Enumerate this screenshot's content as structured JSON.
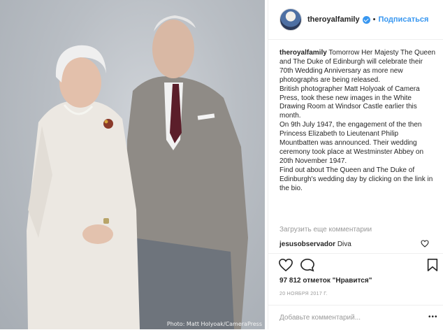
{
  "post": {
    "photo_credit": "Photo: Matt Holyoak/CameraPress"
  },
  "header": {
    "username": "theroyalfamily",
    "separator": "•",
    "follow_label": "Подписаться"
  },
  "caption": {
    "username": "theroyalfamily",
    "paragraphs": [
      "Tomorrow Her Majesty The Queen and The Duke of Edinburgh will celebrate their 70th Wedding Anniversary as more new photographs are being released.",
      "British photographer Matt Holyoak of Camera Press, took these new images in the White Drawing Room at Windsor Castle earlier this month.",
      "On 9th July 1947, the engagement of the then Princess Elizabeth to Lieutenant Philip Mountbatten was announced. Their wedding ceremony took place at Westminster Abbey on 20th November 1947.",
      "Find out about The Queen and The Duke of Edinburgh's wedding day by clicking on the link in the bio."
    ]
  },
  "comments": {
    "load_more_label": "Загрузить еще комментарии",
    "items": [
      {
        "username": "jesusobservador",
        "text": "Diva"
      }
    ]
  },
  "likes": {
    "text": "97 812 отметок \"Нравится\""
  },
  "date": "20 НОЯБРЯ 2017 Г.",
  "comment_input": {
    "placeholder": "Добавьте комментарий..."
  },
  "icons": {
    "like": "heart-icon",
    "comment": "comment-bubble-icon",
    "save": "bookmark-icon",
    "comment_like": "small-heart-icon",
    "more": "more-options-icon",
    "verified": "verified-badge-icon"
  },
  "colors": {
    "accent": "#3897f0",
    "muted": "#999999",
    "text": "#262626",
    "border": "#efefef"
  }
}
